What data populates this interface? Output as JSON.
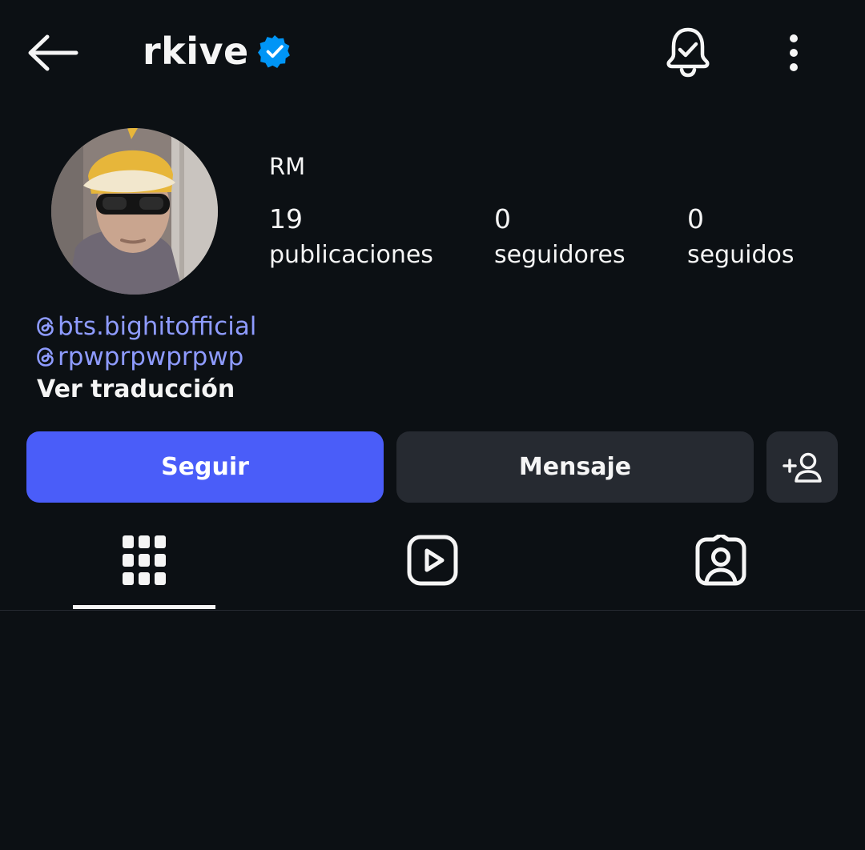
{
  "header": {
    "username": "rkive",
    "verified": true,
    "back_icon": "arrow-left-icon",
    "notifications_icon": "bell-check-icon",
    "more_icon": "more-vertical-icon"
  },
  "profile": {
    "display_name": "RM",
    "avatar_icon": "profile-photo",
    "stats": {
      "posts_value": "19",
      "posts_label": "publicaciones",
      "followers_value": "0",
      "followers_label": "seguidores",
      "following_value": "0",
      "following_label": "seguidos"
    },
    "bio_links": [
      {
        "text": "bts.bighitofficial",
        "icon": "threads-icon"
      },
      {
        "text": "rpwprpwprpwp",
        "icon": "threads-icon"
      }
    ],
    "translate_label": "Ver traducción"
  },
  "actions": {
    "follow_label": "Seguir",
    "message_label": "Mensaje",
    "suggest_icon": "add-user-icon"
  },
  "tabs": [
    {
      "name": "posts",
      "icon": "grid-icon",
      "active": true
    },
    {
      "name": "reels",
      "icon": "reels-icon",
      "active": false
    },
    {
      "name": "tagged",
      "icon": "tagged-icon",
      "active": false
    }
  ],
  "colors": {
    "background": "#0c1014",
    "accent": "#4a5df9",
    "link": "#8e9bff",
    "secondary_button": "#262a31",
    "verified_badge": "#0095f6"
  }
}
